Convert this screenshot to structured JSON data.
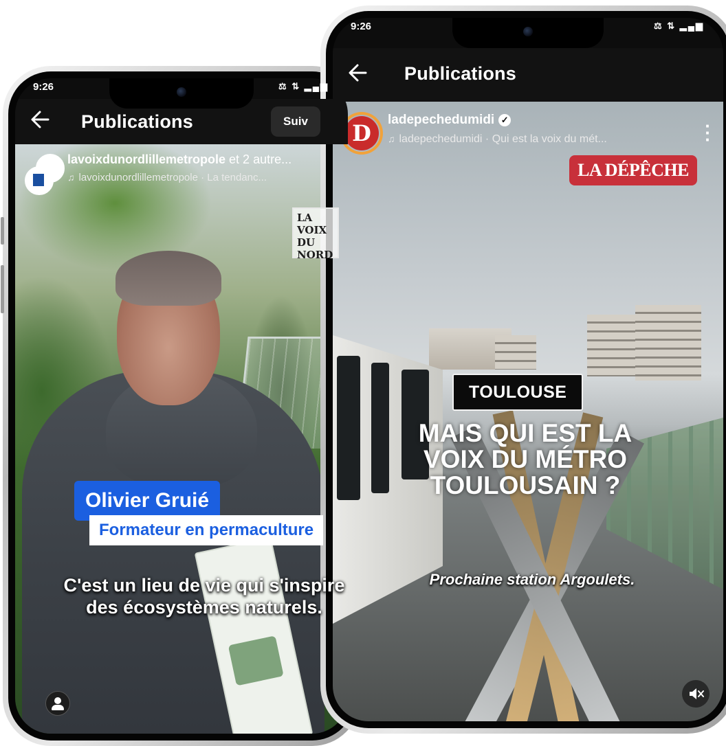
{
  "left_phone": {
    "status": {
      "time": "9:26",
      "icons": "⚖ ⇅ ▂▄▆"
    },
    "nav": {
      "title": "Publications",
      "follow_label": "Suiv"
    },
    "post": {
      "username": "lavoixdunordlillemetropole",
      "collab_suffix": " et 2 autre...",
      "audio": "lavoixdunordlillemetropole · La tendanc..."
    },
    "watermark": [
      "LA",
      "VOIX",
      "DU",
      "NORD"
    ],
    "name_tag": "Olivier Gruié",
    "role_tag": "Formateur en permaculture",
    "subtitle": "C'est un lieu de vie qui s'inspire des écosystèmes naturels."
  },
  "right_phone": {
    "status": {
      "time": "9:26",
      "icons": "⚖ ⇅ ▂▄▆"
    },
    "nav": {
      "title": "Publications"
    },
    "post": {
      "username": "ladepechedumidi",
      "audio": "ladepechedumidi · Qui est la voix du mét..."
    },
    "watermark": "LA DÉPÊCHE",
    "city_tag": "TOULOUSE",
    "headline": "MAIS QUI EST LA VOIX DU MÉTRO TOULOUSAIN ?",
    "subtitle": "Prochaine station Argoulets."
  },
  "icons": {
    "back": "back-arrow-icon",
    "music": "music-note-icon",
    "verified": "verified-badge-icon",
    "more": "more-vertical-icon",
    "mute": "speaker-muted-icon",
    "profile": "person-icon"
  },
  "colors": {
    "name_tag_bg": "#1b5fe0",
    "depeche_red": "#c8303a",
    "nav_bg": "#121212"
  }
}
